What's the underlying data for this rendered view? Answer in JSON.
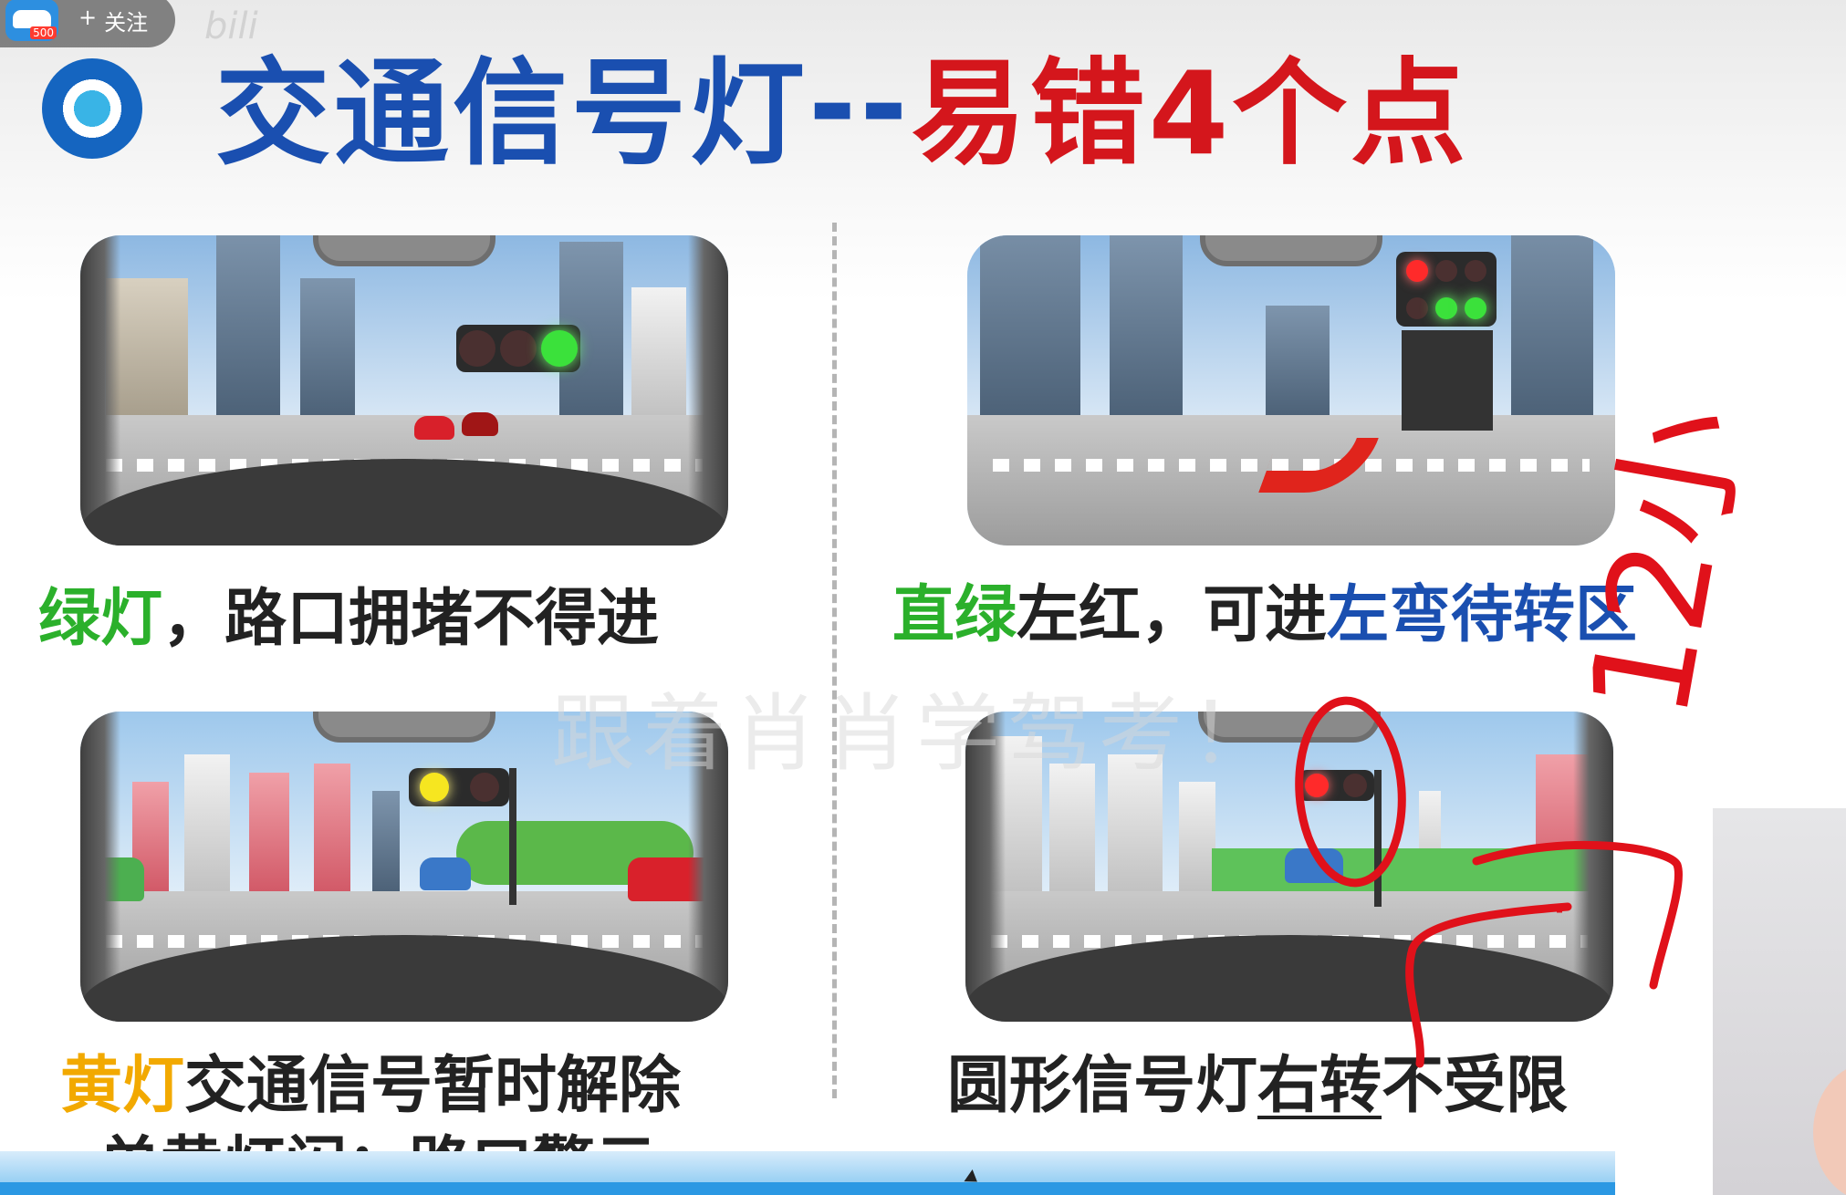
{
  "overlay": {
    "follow_label": "关注",
    "follow_plus": "+",
    "avatar_badge": "500",
    "top_watermark": "bili"
  },
  "title": {
    "blue_part": "交通信号灯",
    "separator": "--",
    "red_part": "易错4个点"
  },
  "panels": [
    {
      "id": "green-light",
      "lights": [
        "off",
        "off",
        "green"
      ],
      "caption": [
        {
          "text": "绿灯",
          "style": "green"
        },
        {
          "text": "，路口拥堵不得进",
          "style": "dark"
        }
      ]
    },
    {
      "id": "straight-green-left-red",
      "lights": [
        "red-arrow-left",
        "green-arrow-up",
        "green-arrow-right"
      ],
      "caption": [
        {
          "text": "直绿",
          "style": "green"
        },
        {
          "text": "左红，可进",
          "style": "dark"
        },
        {
          "text": "左弯待转区",
          "style": "blue"
        }
      ]
    },
    {
      "id": "yellow-light",
      "lights": [
        "yellow",
        "off"
      ],
      "caption": [
        {
          "text": "黄灯",
          "style": "yellow"
        },
        {
          "text": "交通信号暂时解除",
          "style": "dark"
        }
      ],
      "caption2": "单黄灯闪：路口警示"
    },
    {
      "id": "round-red-right-turn",
      "lights": [
        "red",
        "off"
      ],
      "caption": [
        {
          "text": "圆形信号灯",
          "style": "dark"
        },
        {
          "text": "右转",
          "style": "dark-underline"
        },
        {
          "text": "不受限",
          "style": "dark"
        }
      ]
    }
  ],
  "watermark_center": "跟着肖肖学驾考！",
  "annotation": {
    "handwritten_text": "12小",
    "color": "#e0111a"
  },
  "colors": {
    "title_blue": "#1a4fb0",
    "title_red": "#d4161c",
    "caption_green": "#2bb02b",
    "caption_blue": "#1a4fb0",
    "caption_yellow": "#f2a900"
  }
}
